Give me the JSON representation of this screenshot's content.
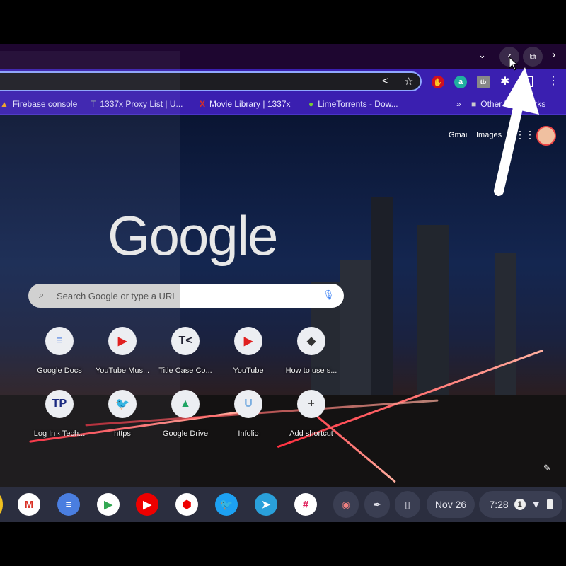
{
  "bookmarks": [
    {
      "label": "Firebase console",
      "icon": "firebase-icon"
    },
    {
      "label": "1337x Proxy List | U...",
      "icon": "proxy-icon"
    },
    {
      "label": "Movie Library | 1337x",
      "icon": "x-icon"
    },
    {
      "label": "LimeTorrents - Dow...",
      "icon": "lime-icon"
    }
  ],
  "bookmarks_overflow": "»",
  "other_bookmarks": "Other bookmarks",
  "header": {
    "gmail": "Gmail",
    "images": "Images"
  },
  "logo": "Google",
  "search": {
    "placeholder": "Search Google or type a URL"
  },
  "shortcuts": [
    {
      "label": "Google Docs",
      "glyph": "≡",
      "color": "#4a7ee0"
    },
    {
      "label": "YouTube Mus...",
      "glyph": "▶",
      "color": "#e02020"
    },
    {
      "label": "Title Case Co...",
      "glyph": "T<",
      "color": "#223"
    },
    {
      "label": "YouTube",
      "glyph": "▶",
      "color": "#e02020"
    },
    {
      "label": "How to use s...",
      "glyph": "◆",
      "color": "#333"
    },
    {
      "label": "Log In ‹ Tech...",
      "glyph": "TP",
      "color": "#1a2a80"
    },
    {
      "label": "https",
      "glyph": "🐦",
      "color": "#1da1f2"
    },
    {
      "label": "Google Drive",
      "glyph": "▲",
      "color": "#1fa463"
    },
    {
      "label": "Infolio",
      "glyph": "U",
      "color": "#7aaee0"
    },
    {
      "label": "Add shortcut",
      "glyph": "+",
      "color": "#333"
    }
  ],
  "shelf": {
    "date": "Nov 26",
    "time": "7:28",
    "notification_count": "1",
    "apps": [
      {
        "name": "gmail",
        "glyph": "M",
        "color": "#d93025",
        "bg": "#fff"
      },
      {
        "name": "google-docs",
        "glyph": "≡",
        "color": "#fff",
        "bg": "#4a7ee0"
      },
      {
        "name": "play-store",
        "glyph": "▶",
        "color": "#34a853",
        "bg": "#fff"
      },
      {
        "name": "youtube-music",
        "glyph": "▶",
        "color": "#fff",
        "bg": "#e00"
      },
      {
        "name": "youtube-create",
        "glyph": "⬢",
        "color": "#e00",
        "bg": "#fff"
      },
      {
        "name": "twitter",
        "glyph": "🐦",
        "color": "#fff",
        "bg": "#1da1f2"
      },
      {
        "name": "telegram",
        "glyph": "➤",
        "color": "#fff",
        "bg": "#2aa0da"
      },
      {
        "name": "slack",
        "glyph": "#",
        "color": "#e01e5a",
        "bg": "#fff"
      }
    ]
  },
  "extensions": [
    {
      "name": "adblock",
      "glyph": "✋",
      "bg": "#d01020"
    },
    {
      "name": "amazon-assistant",
      "glyph": "a",
      "bg": "#20b0a0"
    },
    {
      "name": "tb-extension",
      "glyph": "tb",
      "bg": "#888"
    }
  ]
}
